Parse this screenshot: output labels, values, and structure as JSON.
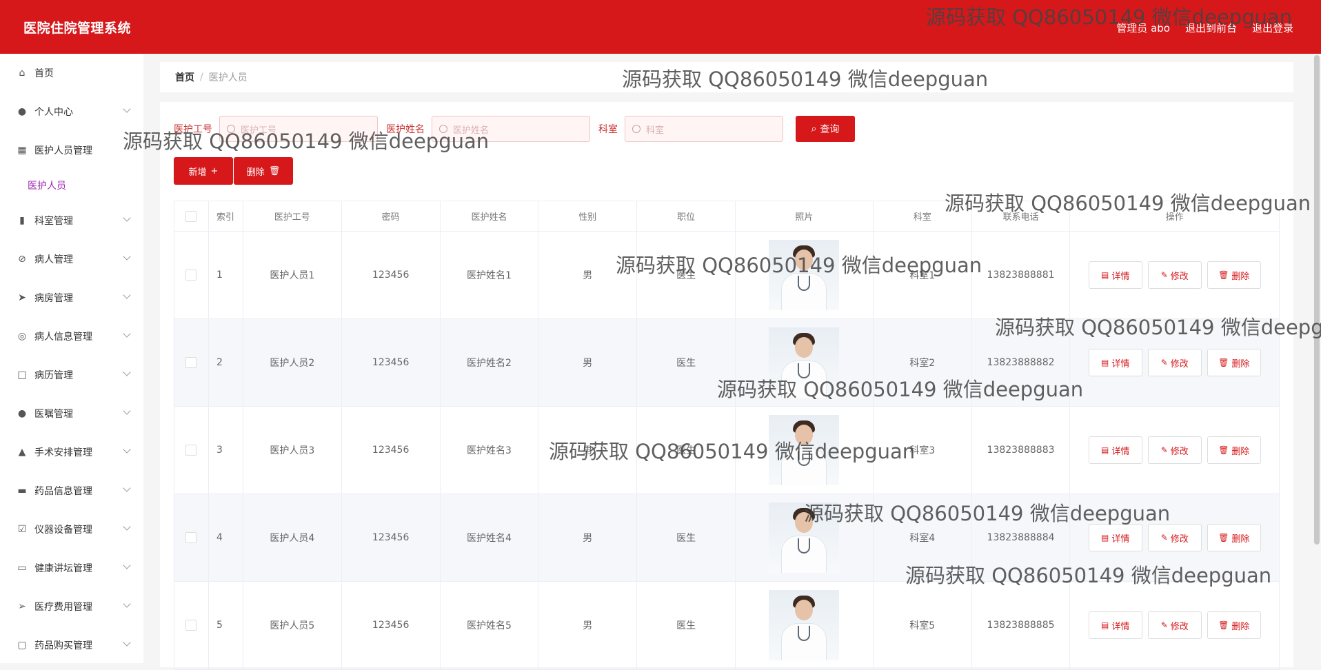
{
  "app": {
    "title": "医院住院管理系统",
    "top_links": [
      "管理员 abo",
      "退出到前台",
      "退出登录"
    ]
  },
  "sidebar": {
    "items": [
      {
        "label": "首页",
        "icon": "home-icon",
        "expandable": false
      },
      {
        "label": "个人中心",
        "icon": "user-icon",
        "expandable": true
      },
      {
        "label": "医护人员管理",
        "icon": "grid-icon",
        "expandable": false
      },
      {
        "label": "医护人员",
        "icon": "",
        "expandable": false,
        "sub": true
      },
      {
        "label": "科室管理",
        "icon": "bar-chart-icon",
        "expandable": true
      },
      {
        "label": "病人管理",
        "icon": "no-sign-icon",
        "expandable": true
      },
      {
        "label": "病房管理",
        "icon": "send-icon",
        "expandable": true
      },
      {
        "label": "病人信息管理",
        "icon": "compass-icon",
        "expandable": true
      },
      {
        "label": "病历管理",
        "icon": "square-icon",
        "expandable": true
      },
      {
        "label": "医嘱管理",
        "icon": "person-icon",
        "expandable": true
      },
      {
        "label": "手术安排管理",
        "icon": "trend-icon",
        "expandable": true
      },
      {
        "label": "药品信息管理",
        "icon": "stack-icon",
        "expandable": true
      },
      {
        "label": "仪器设备管理",
        "icon": "clipboard-check-icon",
        "expandable": true
      },
      {
        "label": "健康讲坛管理",
        "icon": "briefcase-icon",
        "expandable": true
      },
      {
        "label": "医疗费用管理",
        "icon": "navigation-icon",
        "expandable": true
      },
      {
        "label": "药品购买管理",
        "icon": "chat-icon",
        "expandable": true
      }
    ]
  },
  "breadcrumb": {
    "home": "首页",
    "separator": "/",
    "current": "医护人员"
  },
  "search": {
    "fields": [
      {
        "label": "医护工号",
        "placeholder": "医护工号"
      },
      {
        "label": "医护姓名",
        "placeholder": "医护姓名"
      },
      {
        "label": "科室",
        "placeholder": "科室"
      }
    ],
    "query_label": "查询"
  },
  "actions": {
    "add_label": "新增",
    "delete_label": "删除"
  },
  "table": {
    "columns": [
      "索引",
      "医护工号",
      "密码",
      "医护姓名",
      "性别",
      "职位",
      "照片",
      "科室",
      "联系电话",
      "操作"
    ],
    "rows": [
      {
        "index": "1",
        "no": "医护人员1",
        "pwd": "123456",
        "name": "医护姓名1",
        "sex": "男",
        "pos": "医生",
        "dept": "科室1",
        "phone": "13823888881"
      },
      {
        "index": "2",
        "no": "医护人员2",
        "pwd": "123456",
        "name": "医护姓名2",
        "sex": "男",
        "pos": "医生",
        "dept": "科室2",
        "phone": "13823888882"
      },
      {
        "index": "3",
        "no": "医护人员3",
        "pwd": "123456",
        "name": "医护姓名3",
        "sex": "男",
        "pos": "医生",
        "dept": "科室3",
        "phone": "13823888883"
      },
      {
        "index": "4",
        "no": "医护人员4",
        "pwd": "123456",
        "name": "医护姓名4",
        "sex": "男",
        "pos": "医生",
        "dept": "科室4",
        "phone": "13823888884"
      },
      {
        "index": "5",
        "no": "医护人员5",
        "pwd": "123456",
        "name": "医护姓名5",
        "sex": "男",
        "pos": "医生",
        "dept": "科室5",
        "phone": "13823888885"
      }
    ],
    "op_labels": {
      "detail": "详情",
      "edit": "修改",
      "delete": "删除"
    }
  },
  "watermark": "源码获取 QQ86050149 微信deepguan",
  "colors": {
    "accent": "#d6181b",
    "sub_item": "#9c27b0"
  }
}
